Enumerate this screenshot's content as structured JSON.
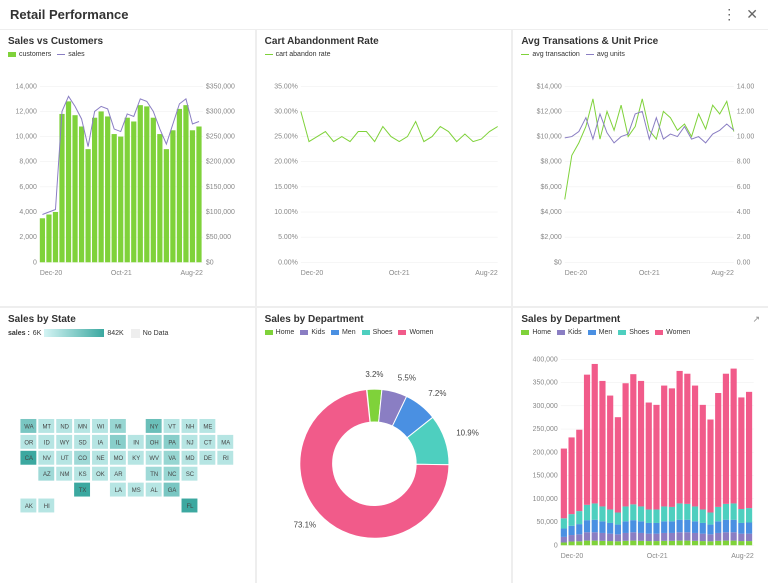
{
  "header": {
    "title": "Retail Performance",
    "more_label": "⋮",
    "close_label": "✕"
  },
  "panels": {
    "sales_vs_customers": {
      "title": "Sales vs Customers",
      "legend": [
        {
          "label": "customers",
          "color": "#7fd23a"
        },
        {
          "label": "sales",
          "color": "#8a7ec3"
        }
      ]
    },
    "cart": {
      "title": "Cart Abandonment Rate",
      "legend": [
        {
          "label": "cart abandon rate",
          "color": "#7fd23a"
        }
      ]
    },
    "avg": {
      "title": "Avg Transations & Unit Price",
      "legend": [
        {
          "label": "avg transaction",
          "color": "#7fd23a"
        },
        {
          "label": "avg units",
          "color": "#8a7ec3"
        }
      ]
    },
    "state": {
      "title": "Sales by State",
      "legend_label": "sales :",
      "min": "6K",
      "max": "842K",
      "nodata": "No Data"
    },
    "dept_donut": {
      "title": "Sales by Department",
      "legend": [
        {
          "label": "Home",
          "color": "#7fd23a"
        },
        {
          "label": "Kids",
          "color": "#8a7ec3"
        },
        {
          "label": "Men",
          "color": "#4a90e2"
        },
        {
          "label": "Shoes",
          "color": "#4ecfbf"
        },
        {
          "label": "Women",
          "color": "#f15b8a"
        }
      ]
    },
    "dept_bar": {
      "title": "Sales by Department",
      "legend": [
        {
          "label": "Home",
          "color": "#7fd23a"
        },
        {
          "label": "Kids",
          "color": "#8a7ec3"
        },
        {
          "label": "Men",
          "color": "#4a90e2"
        },
        {
          "label": "Shoes",
          "color": "#4ecfbf"
        },
        {
          "label": "Women",
          "color": "#f15b8a"
        }
      ]
    }
  },
  "colors": {
    "green": "#7fd23a",
    "purple": "#8a7ec3",
    "blue": "#4a90e2",
    "teal": "#4ecfbf",
    "pink": "#f15b8a",
    "map_lo": "#d4f4f4",
    "map_hi": "#3ba8a0"
  },
  "chart_data": [
    {
      "id": "sales_vs_customers",
      "type": "bar+line",
      "x_ticks": [
        "Dec-20",
        "Oct-21",
        "Aug-22"
      ],
      "y_left": {
        "label": "",
        "range": [
          0,
          14000
        ],
        "ticks": [
          0,
          2000,
          4000,
          6000,
          8000,
          10000,
          12000,
          14000
        ]
      },
      "y_right": {
        "label": "",
        "range": [
          0,
          350000
        ],
        "ticks": [
          0,
          50000,
          100000,
          150000,
          200000,
          250000,
          300000,
          350000
        ],
        "fmt": "$"
      },
      "categories": [
        "Dec-20",
        "Jan-21",
        "Feb-21",
        "Mar-21",
        "Apr-21",
        "May-21",
        "Jun-21",
        "Jul-21",
        "Aug-21",
        "Sep-21",
        "Oct-21",
        "Nov-21",
        "Dec-21",
        "Jan-22",
        "Feb-22",
        "Mar-22",
        "Apr-22",
        "May-22",
        "Jun-22",
        "Jul-22",
        "Aug-22",
        "Sep-22",
        "Oct-22",
        "Nov-22",
        "Dec-22"
      ],
      "series": [
        {
          "name": "customers",
          "kind": "bar",
          "axis": "left",
          "values": [
            3500,
            3800,
            4000,
            11800,
            12800,
            11700,
            10800,
            9000,
            11500,
            12000,
            11600,
            10200,
            10000,
            11500,
            11200,
            12500,
            12400,
            11500,
            10200,
            9000,
            10500,
            12200,
            12500,
            10500,
            10800
          ]
        },
        {
          "name": "sales",
          "kind": "line",
          "axis": "right",
          "values": [
            95000,
            100000,
            105000,
            300000,
            330000,
            310000,
            285000,
            230000,
            300000,
            310000,
            305000,
            265000,
            260000,
            295000,
            290000,
            325000,
            320000,
            300000,
            265000,
            235000,
            275000,
            315000,
            325000,
            275000,
            280000
          ]
        }
      ]
    },
    {
      "id": "cart",
      "type": "line",
      "x_ticks": [
        "Dec-20",
        "Oct-21",
        "Aug-22"
      ],
      "y_left": {
        "range": [
          0,
          35
        ],
        "ticks": [
          0,
          5,
          10,
          15,
          20,
          25,
          30,
          35
        ],
        "fmt": "%"
      },
      "categories": [
        "Dec-20",
        "Jan-21",
        "Feb-21",
        "Mar-21",
        "Apr-21",
        "May-21",
        "Jun-21",
        "Jul-21",
        "Aug-21",
        "Sep-21",
        "Oct-21",
        "Nov-21",
        "Dec-21",
        "Jan-22",
        "Feb-22",
        "Mar-22",
        "Apr-22",
        "May-22",
        "Jun-22",
        "Jul-22",
        "Aug-22",
        "Sep-22",
        "Oct-22",
        "Nov-22",
        "Dec-22"
      ],
      "series": [
        {
          "name": "cart abandon rate",
          "kind": "line",
          "values": [
            30,
            24,
            25,
            26,
            24,
            25,
            24,
            26,
            26,
            24,
            27,
            25,
            24,
            25,
            28,
            24,
            25,
            27,
            26,
            24,
            25.5,
            24,
            24.5,
            26,
            27
          ]
        }
      ]
    },
    {
      "id": "avg",
      "type": "line",
      "x_ticks": [
        "Dec-20",
        "Oct-21",
        "Aug-22"
      ],
      "y_left": {
        "range": [
          0,
          14000
        ],
        "ticks": [
          0,
          2000,
          4000,
          6000,
          8000,
          10000,
          12000,
          14000
        ],
        "fmt": "$"
      },
      "y_right": {
        "range": [
          0,
          14
        ],
        "ticks": [
          0,
          2,
          4,
          6,
          8,
          10,
          12,
          14
        ]
      },
      "categories": [
        "Dec-20",
        "Jan-21",
        "Feb-21",
        "Mar-21",
        "Apr-21",
        "May-21",
        "Jun-21",
        "Jul-21",
        "Aug-21",
        "Sep-21",
        "Oct-21",
        "Nov-21",
        "Dec-21",
        "Jan-22",
        "Feb-22",
        "Mar-22",
        "Apr-22",
        "May-22",
        "Jun-22",
        "Jul-22",
        "Aug-22",
        "Sep-22",
        "Oct-22",
        "Nov-22",
        "Dec-22"
      ],
      "series": [
        {
          "name": "avg transaction",
          "kind": "line",
          "axis": "left",
          "values": [
            5000,
            8500,
            9500,
            10800,
            13000,
            9800,
            12000,
            10500,
            12500,
            10000,
            10800,
            13000,
            10500,
            9800,
            12000,
            11500,
            10500,
            11000,
            10000,
            11800,
            10600,
            12500,
            11800,
            12800,
            10400
          ]
        },
        {
          "name": "avg units",
          "kind": "line",
          "axis": "right",
          "values": [
            9.9,
            10.0,
            10.4,
            11.5,
            9.8,
            11.8,
            10.3,
            9.5,
            10.0,
            10.2,
            11.8,
            12.0,
            9.8,
            11.5,
            9.8,
            10.2,
            10.0,
            10.8,
            9.8,
            10.0,
            9.5,
            10.2,
            10.5,
            11.0,
            10.5
          ]
        }
      ]
    },
    {
      "id": "dept_donut",
      "type": "pie",
      "slices": [
        {
          "name": "Women",
          "value": 73.1,
          "color": "#f15b8a"
        },
        {
          "name": "Shoes",
          "value": 10.9,
          "color": "#4ecfbf"
        },
        {
          "name": "Men",
          "value": 7.2,
          "color": "#4a90e2"
        },
        {
          "name": "Kids",
          "value": 5.5,
          "color": "#8a7ec3"
        },
        {
          "name": "Home",
          "value": 3.2,
          "color": "#7fd23a"
        }
      ],
      "labels": [
        "73.1%",
        "10.9%",
        "7.2%",
        "5.5%",
        "3.2%"
      ]
    },
    {
      "id": "dept_bar",
      "type": "stacked-bar",
      "x_ticks": [
        "Dec-20",
        "Oct-21",
        "Aug-22"
      ],
      "y_left": {
        "range": [
          0,
          400000
        ],
        "ticks": [
          0,
          50000,
          100000,
          150000,
          200000,
          250000,
          300000,
          350000,
          400000
        ]
      },
      "categories": [
        "Dec-20",
        "Jan-21",
        "Feb-21",
        "Mar-21",
        "Apr-21",
        "May-21",
        "Jun-21",
        "Jul-21",
        "Aug-21",
        "Sep-21",
        "Oct-21",
        "Nov-21",
        "Dec-21",
        "Jan-22",
        "Feb-22",
        "Mar-22",
        "Apr-22",
        "May-22",
        "Jun-22",
        "Jul-22",
        "Aug-22",
        "Sep-22",
        "Oct-22",
        "Nov-22",
        "Dec-22"
      ],
      "series": [
        {
          "name": "Home",
          "values": [
            6000,
            8000,
            8500,
            10000,
            10000,
            9500,
            9000,
            8500,
            9500,
            10000,
            9500,
            9000,
            9000,
            9500,
            9500,
            10000,
            10000,
            9500,
            9000,
            8500,
            9500,
            10000,
            10000,
            9000,
            9000
          ]
        },
        {
          "name": "Kids",
          "values": [
            12000,
            14000,
            15000,
            18000,
            18000,
            17000,
            16000,
            15000,
            17000,
            18000,
            17000,
            16000,
            16000,
            17000,
            17000,
            18000,
            18000,
            17000,
            16000,
            15000,
            17000,
            18000,
            18000,
            16000,
            16000
          ]
        },
        {
          "name": "Men",
          "values": [
            18000,
            20000,
            22000,
            26000,
            27000,
            25000,
            23000,
            21000,
            25000,
            26000,
            25000,
            23000,
            23000,
            25000,
            25000,
            27000,
            27000,
            25000,
            23000,
            21000,
            25000,
            27000,
            27000,
            23000,
            24000
          ]
        },
        {
          "name": "Shoes",
          "values": [
            22000,
            25000,
            28000,
            33000,
            35000,
            32000,
            29000,
            26000,
            32000,
            34000,
            32000,
            29000,
            29000,
            32000,
            31000,
            35000,
            34000,
            32000,
            29000,
            26000,
            31000,
            34000,
            35000,
            30000,
            31000
          ]
        },
        {
          "name": "Women",
          "values": [
            150000,
            165000,
            175000,
            280000,
            300000,
            270000,
            245000,
            205000,
            265000,
            280000,
            270000,
            230000,
            225000,
            260000,
            255000,
            285000,
            280000,
            260000,
            225000,
            200000,
            245000,
            280000,
            290000,
            240000,
            250000
          ]
        }
      ]
    }
  ],
  "map_states": [
    "WA",
    "OR",
    "CA",
    "NV",
    "ID",
    "UT",
    "AZ",
    "MT",
    "WY",
    "CO",
    "NM",
    "ND",
    "SD",
    "NE",
    "KS",
    "OK",
    "TX",
    "MN",
    "IA",
    "MO",
    "AR",
    "LA",
    "WI",
    "MI",
    "IL",
    "IN",
    "OH",
    "KY",
    "TN",
    "MS",
    "AL",
    "GA",
    "FL",
    "SC",
    "NC",
    "VA",
    "WV",
    "PA",
    "NY",
    "MD",
    "DE",
    "NJ",
    "CT",
    "RI",
    "MA",
    "VT",
    "NH",
    "ME",
    "HI",
    "AK"
  ]
}
